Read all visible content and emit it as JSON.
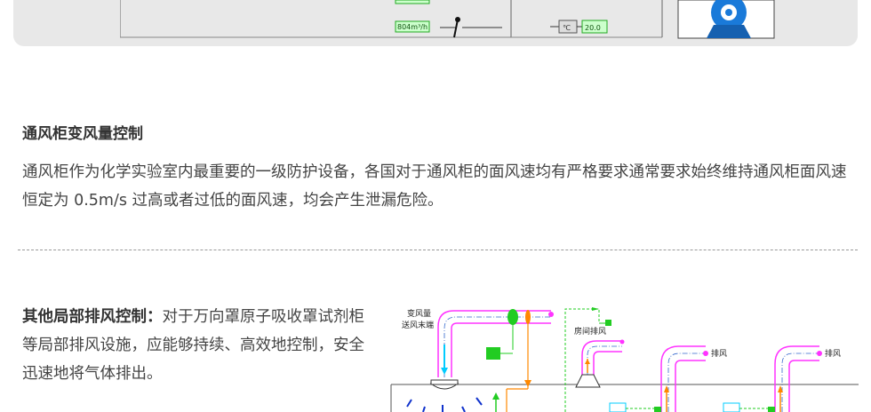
{
  "top_diagram": {
    "airflow_readout": "804m³/h",
    "temperature_unit": "℃",
    "temperature_value": "20.0"
  },
  "section1": {
    "title": "通风柜变风量控制",
    "body": "通风柜作为化学实验室内最重要的一级防护设备，各国对于通风柜的面风速均有严格要求通常要求始终维持通风柜面风速恒定为 0.5m/s 过高或者过低的面风速，均会产生泄漏危险。"
  },
  "section2": {
    "title": "其他局部排风控制：",
    "body": "对于万向罩原子吸收罩试剂柜等局部排风设施，应能够持续、高效地控制，安全迅速地将气体排出。"
  },
  "diagram2": {
    "label_supply_line1": "变风量",
    "label_supply_line2": "送风末端",
    "label_room_exhaust": "房间排风",
    "label_exhaust_1": "排风",
    "label_exhaust_2": "排风"
  },
  "colors": {
    "card_bg": "#e8e8e8",
    "duct_magenta": "#ff33ff",
    "duct_cyan": "#00ccff",
    "valve_green": "#22cc22",
    "control_orange": "#ff8800",
    "readout_green": "#ccffcc",
    "fan_blue": "#1a7ad9"
  },
  "icons": [
    "fan-icon",
    "thermometer-sensor-icon",
    "air-valve-icon"
  ]
}
